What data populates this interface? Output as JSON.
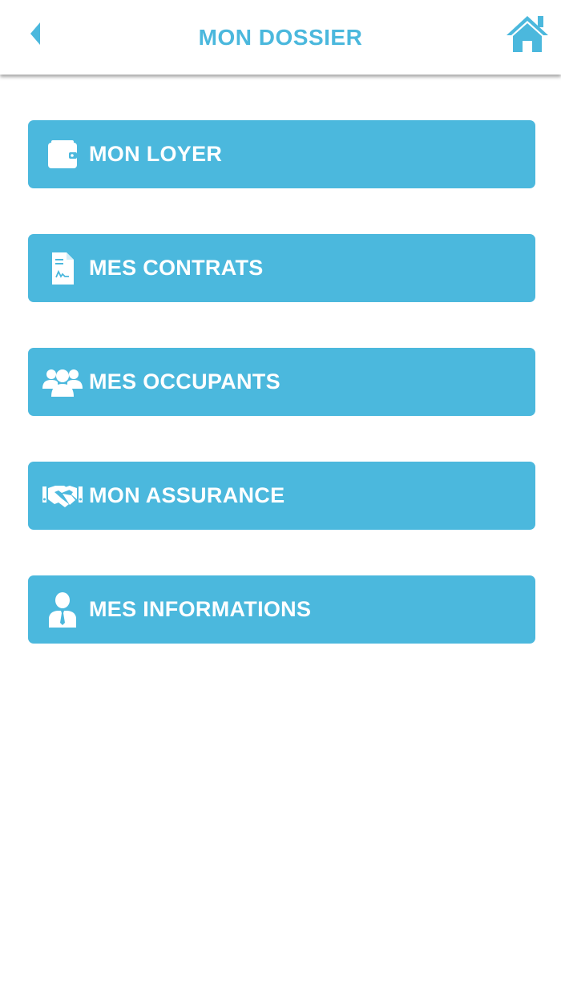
{
  "colors": {
    "accent": "#4bb8dd",
    "background": "#ffffff",
    "button_text": "#ffffff"
  },
  "header": {
    "title": "MON DOSSIER",
    "back_icon": "chevron-left-icon",
    "home_icon": "home-icon"
  },
  "menu": {
    "items": [
      {
        "label": "MON LOYER",
        "icon": "wallet-icon"
      },
      {
        "label": "MES CONTRATS",
        "icon": "contract-document-icon"
      },
      {
        "label": "MES OCCUPANTS",
        "icon": "users-group-icon"
      },
      {
        "label": "MON ASSURANCE",
        "icon": "handshake-icon"
      },
      {
        "label": "MES INFORMATIONS",
        "icon": "user-tie-icon"
      }
    ]
  }
}
